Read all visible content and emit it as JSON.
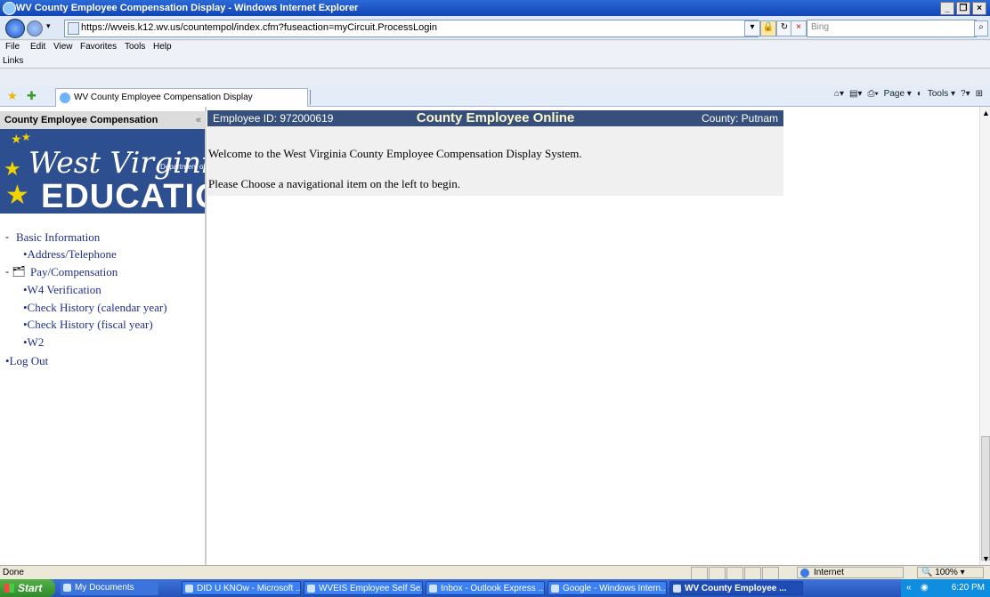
{
  "window": {
    "title": "WV County Employee Compensation Display - Windows Internet Explorer",
    "controls": [
      "_",
      "❐",
      "×"
    ]
  },
  "addressbar": {
    "url": "https://wveis.k12.wv.us/countempol/index.cfm?fuseaction=myCircuit.ProcessLogin",
    "search_placeholder": "Bing"
  },
  "menubar": {
    "items": [
      "File",
      "Edit",
      "View",
      "Favorites",
      "Tools",
      "Help"
    ],
    "links_label": "Links"
  },
  "tabbar": {
    "tab_title": "WV County Employee Compensation Display",
    "commands": [
      "Page ▾",
      "Tools ▾"
    ]
  },
  "sidebar": {
    "header": "County Employee Compensation",
    "collapse": "«",
    "logo": {
      "line1": "West Virginia",
      "line2": "Department of",
      "line3": "EDUCATION"
    },
    "nav": [
      {
        "label": "Basic Information",
        "toggle": "-"
      },
      {
        "label": "•Address/Telephone"
      },
      {
        "label": "Pay/Compensation",
        "toggle": "- 🗂"
      },
      {
        "label": "•W4 Verification"
      },
      {
        "label": "•Check History (calendar year)"
      },
      {
        "label": "•Check History (fiscal year)"
      },
      {
        "label": "•W2"
      },
      {
        "label": "•Log Out"
      }
    ]
  },
  "main": {
    "employee_id": "Employee ID:  972000619",
    "title": "County Employee Online",
    "county": "County:  Putnam",
    "welcome": "Welcome to the West Virginia County Employee Compensation Display System.",
    "instruction": "Please Choose a navigational item on the left to begin."
  },
  "statusbar": {
    "status": "Done",
    "zone": "Internet",
    "zoom": "100%"
  },
  "taskbar": {
    "start": "Start",
    "items": [
      "My Documents",
      "DID U KNOw - Microsoft ...",
      "WVEIS Employee Self Se...",
      "Inbox - Outlook Express ...",
      "Google - Windows Intern...",
      "WV County Employee ..."
    ],
    "time": "6:20 PM"
  }
}
